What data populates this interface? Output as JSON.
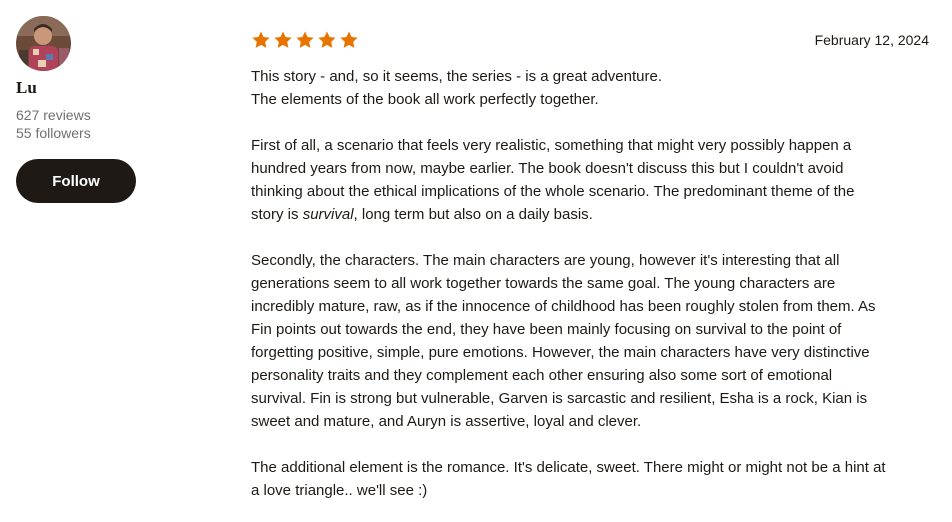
{
  "reviewer": {
    "name": "Lu",
    "reviews": "627 reviews",
    "followers": "55 followers",
    "follow_label": "Follow"
  },
  "review": {
    "rating": 5,
    "rating_max": 5,
    "star_color": "#e87400",
    "date": "February 12, 2024",
    "paragraphs": [
      {
        "lines": [
          "This story - and, so it seems, the series - is a great adventure.",
          "The elements of the book all work perfectly together."
        ]
      },
      {
        "lines": [
          "First of all, a scenario that feels very realistic, something that might very possibly happen a",
          "hundred years from now, maybe earlier. The book doesn't discuss this but I couldn't avoid",
          "thinking about the ethical implications of the whole scenario. The predominant theme of the"
        ],
        "last_line": {
          "before": "story is ",
          "emphasis": "survival",
          "after": ", long term but also on a daily basis."
        }
      },
      {
        "lines": [
          "Secondly, the characters. The main characters are young, however it's interesting that all",
          "generations seem to all work together towards the same goal. The young characters are",
          "incredibly mature, raw, as if the innocence of childhood has been roughly stolen from them. As",
          "Fin points out towards the end, they have been mainly focusing on survival to the point of",
          "forgetting positive, simple, pure emotions. However, the main characters have very distinctive",
          "personality traits and they complement each other ensuring also some sort of emotional",
          "survival. Fin is strong but vulnerable, Garven is sarcastic and resilient, Esha is a rock, Kian is",
          "sweet and mature, and Auryn is assertive, loyal and clever."
        ]
      },
      {
        "lines": [
          "The additional element is the romance. It's delicate, sweet. There might or might not be a hint at",
          "a love triangle.. we'll see :)"
        ]
      }
    ]
  }
}
